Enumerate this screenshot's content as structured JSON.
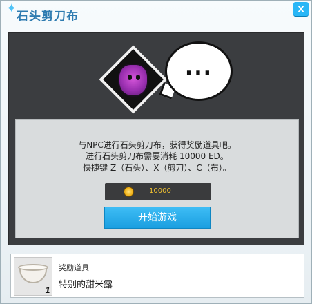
{
  "window": {
    "title": "石头剪刀布",
    "close_label": "x"
  },
  "npc": {
    "speech": "..."
  },
  "info": {
    "line1": "与NPC进行石头剪刀布，获得奖励道具吧。",
    "line2": "进行石头剪刀布需要消耗 10000 ED。",
    "line3": "快捷键 Z（石头）、X（剪刀）、C（布）。"
  },
  "cost": {
    "value": "10000",
    "icon": "coin-icon"
  },
  "actions": {
    "start_label": "开始游戏"
  },
  "reward": {
    "label": "奖励道具",
    "item_name": "特别的甜米露",
    "quantity": "1",
    "icon": "bowl-icon"
  },
  "colors": {
    "accent": "#29b6f6",
    "title": "#2e7bb0",
    "panel": "#3b3d40",
    "coin_text": "#f2c230"
  }
}
